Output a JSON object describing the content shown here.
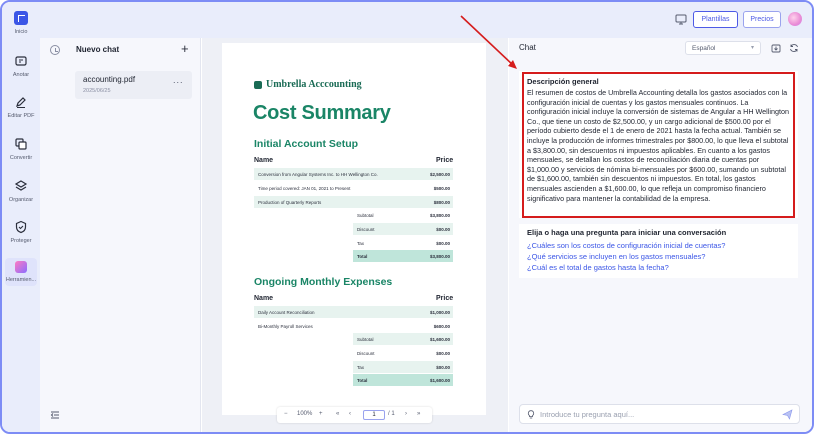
{
  "rail": {
    "items": [
      {
        "label": "Inicio"
      },
      {
        "label": "Anotar"
      },
      {
        "label": "Editar PDF"
      },
      {
        "label": "Convertir"
      },
      {
        "label": "Organizar"
      },
      {
        "label": "Proteger"
      },
      {
        "label": "Herramien..."
      }
    ]
  },
  "topbar": {
    "templates_label": "Plantillas",
    "pricing_label": "Precios"
  },
  "chat_list": {
    "title": "Nuevo chat",
    "new_chat_symbol": "+",
    "document": {
      "name": "accounting.pdf",
      "date": "2025/06/25",
      "more": "..."
    }
  },
  "document": {
    "brand": "Umbrella Acccounting",
    "title": "Cost Summary",
    "initial": {
      "heading": "Initial Account Setup",
      "col_name": "Name",
      "col_price": "Price",
      "rows": [
        {
          "desc": "Conversion from Angular Systems Inc. to HH Wellington Co.",
          "price": "$2,500.00"
        },
        {
          "desc": "Time period covered: JAN 01, 2021 to Present",
          "price": "$500.00"
        },
        {
          "desc": "Production of Quarterly Reports",
          "price": "$800.00"
        }
      ],
      "subtotal": {
        "label": "Subtotal",
        "value": "$3,800.00"
      },
      "discount": {
        "label": "Discount",
        "value": "$00.00"
      },
      "tax": {
        "label": "Tax",
        "value": "$00.00"
      },
      "total": {
        "label": "Total",
        "value": "$3,800.00"
      }
    },
    "monthly": {
      "heading": "Ongoing Monthly Expenses",
      "col_name": "Name",
      "col_price": "Price",
      "rows": [
        {
          "desc": "Daily Account Reconciliation",
          "price": "$1,000.00"
        },
        {
          "desc": "Bi-Monthly Payroll Services",
          "price": "$600.00"
        }
      ],
      "subtotal": {
        "label": "Subtotal",
        "value": "$1,600.00"
      },
      "discount": {
        "label": "Discount",
        "value": "$00.00"
      },
      "tax": {
        "label": "Tax",
        "value": "$00.00"
      },
      "total": {
        "label": "Total",
        "value": "$1,600.00"
      }
    }
  },
  "zoombar": {
    "minus": "−",
    "zoom": "100%",
    "plus": "+",
    "first": "«",
    "prev": "‹",
    "page": "1",
    "of": "/ 1",
    "next": "›",
    "last": "»"
  },
  "chat": {
    "title": "Chat",
    "language": "Español",
    "summary_title": "Descripción general",
    "summary_body": "El resumen de costos de Umbrella Accounting detalla los gastos asociados con la configuración inicial de cuentas y los gastos mensuales continuos. La configuración inicial incluye la conversión de sistemas de Angular a HH Wellington Co., que tiene un costo de $2,500.00, y un cargo adicional de $500.00 por el período cubierto desde el 1 de enero de 2021 hasta la fecha actual. También se incluye la producción de informes trimestrales por $800.00, lo que lleva el subtotal a $3,800.00, sin descuentos ni impuestos aplicables. En cuanto a los gastos mensuales, se detallan los costos de reconciliación diaria de cuentas por $1,000.00 y servicios de nómina bi-mensuales por $600.00, sumando un subtotal de $1,600.00, también sin descuentos ni impuestos. En total, los gastos mensuales ascienden a $1,600.00, lo que refleja un compromiso financiero significativo para mantener la contabilidad de la empresa.",
    "questions_title": "Elija o haga una pregunta para iniciar una conversación",
    "questions": [
      "¿Cuáles son los costos de configuración inicial de cuentas?",
      "¿Qué servicios se incluyen en los gastos mensuales?",
      "¿Cuál es el total de gastos hasta la fecha?"
    ],
    "input_placeholder": "Introduce tu pregunta aquí..."
  },
  "colors": {
    "accent": "#3b56e6",
    "brand_green": "#1a8566",
    "highlight_red": "#d51c1c"
  }
}
